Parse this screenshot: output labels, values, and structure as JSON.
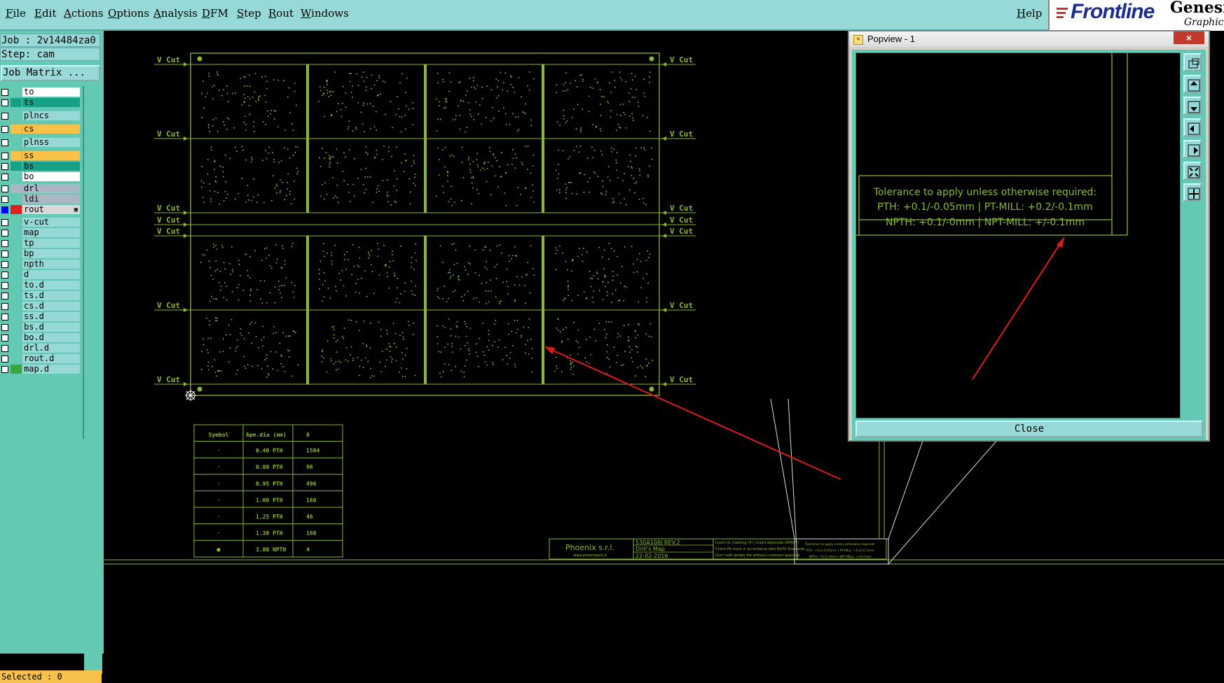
{
  "menu": {
    "items": [
      "File",
      "Edit",
      "Actions",
      "Options",
      "Analysis",
      "DFM",
      "Step",
      "Rout",
      "Windows"
    ],
    "help": "Help"
  },
  "brand": {
    "logo": "Frontline",
    "product": "Genesis",
    "tagline": "Graphic E"
  },
  "job_info": {
    "job": "Job : 2v14484za0",
    "step": "Step: cam",
    "matrix_button": "Job Matrix ..."
  },
  "layers": [
    {
      "name": "to",
      "color": "#ffffff",
      "swatch": "#63c9b3"
    },
    {
      "name": "ts",
      "color": "#16a085",
      "swatch": "#16a085"
    },
    {
      "name": "plncs",
      "color": "#97d9d6",
      "swatch": "#63c9b3"
    },
    {
      "name": "cs",
      "color": "#f7c14a",
      "swatch": "#f7c14a"
    },
    {
      "name": "plnss",
      "color": "#97d9d6",
      "swatch": "#63c9b3"
    },
    {
      "name": "ss",
      "color": "#f7c14a",
      "swatch": "#f7c14a"
    },
    {
      "name": "bs",
      "color": "#16a085",
      "swatch": "#16a085"
    },
    {
      "name": "bo",
      "color": "#ffffff",
      "swatch": "#63c9b3"
    },
    {
      "name": "drl",
      "color": "#a9b8c2",
      "swatch": "#a9b8c2"
    },
    {
      "name": "ldi",
      "color": "#a9b8c2",
      "swatch": "#63c9b3"
    },
    {
      "name": "rout",
      "color": "#d8d8d8",
      "swatch": "#e02020",
      "active": true
    },
    {
      "name": "v-cut",
      "color": "#97d9d6",
      "swatch": "#63c9b3"
    },
    {
      "name": "map",
      "color": "#97d9d6",
      "swatch": "#63c9b3"
    },
    {
      "name": "tp",
      "color": "#97d9d6",
      "swatch": "#63c9b3"
    },
    {
      "name": "bp",
      "color": "#97d9d6",
      "swatch": "#63c9b3"
    },
    {
      "name": "npth",
      "color": "#97d9d6",
      "swatch": "#63c9b3"
    },
    {
      "name": "d",
      "color": "#97d9d6",
      "swatch": "#63c9b3"
    },
    {
      "name": "to.d",
      "color": "#97d9d6",
      "swatch": "#63c9b3"
    },
    {
      "name": "ts.d",
      "color": "#97d9d6",
      "swatch": "#63c9b3"
    },
    {
      "name": "cs.d",
      "color": "#97d9d6",
      "swatch": "#63c9b3"
    },
    {
      "name": "ss.d",
      "color": "#97d9d6",
      "swatch": "#63c9b3"
    },
    {
      "name": "bs.d",
      "color": "#97d9d6",
      "swatch": "#63c9b3"
    },
    {
      "name": "bo.d",
      "color": "#97d9d6",
      "swatch": "#63c9b3"
    },
    {
      "name": "drl.d",
      "color": "#97d9d6",
      "swatch": "#63c9b3"
    },
    {
      "name": "rout.d",
      "color": "#97d9d6",
      "swatch": "#63c9b3"
    },
    {
      "name": "map.d",
      "color": "#97d9d6",
      "swatch": "#3aa53a"
    }
  ],
  "status": {
    "selected": "Selected : 0"
  },
  "canvas": {
    "vcut_label": "V Cut",
    "drill_table": {
      "headers": [
        "Symbol",
        "Ape.dia (mm)",
        "0"
      ],
      "rows": [
        [
          "·",
          "0.40 PTH",
          "1504"
        ],
        [
          "·",
          "0.80 PTH",
          "96"
        ],
        [
          "·",
          "0.95 PTH",
          "496"
        ],
        [
          "·",
          "1.00 PTH",
          "160"
        ],
        [
          "·",
          "1.25 PTH",
          "46"
        ],
        [
          "·",
          "1.30 PTH",
          "160"
        ],
        [
          "●",
          "3.00 NPTH",
          "4"
        ]
      ]
    },
    "title_block": {
      "company": "Phoenix s.r.l.",
      "website": "www.phoenixpcb.it",
      "part": "530A108J REV.2",
      "doc": "Drill's Map",
      "date": "22-02-2016",
      "notes": [
        "Insert UL marking (if) | Insert datecode (WWYY)",
        "Check Pb mark in accordance with RoHS Standards",
        "Don't edit gerber file without customer approval"
      ],
      "tolerance_mini": [
        "Tolerance to apply unless otherwise required:",
        "PTH: +0.1/-0.05mm | PT-MILL: +0.2/-0.1mm",
        "NPTH: +0.1/-0mm | NPT-MILL: +/-0.1mm"
      ]
    }
  },
  "popview": {
    "title": "Popview - 1",
    "close_x": "×",
    "close_button": "Close",
    "tolerance": [
      "Tolerance to apply unless otherwise required:",
      "PTH: +0.1/-0.05mm | PT-MILL: +0.2/-0.1mm",
      "NPTH: +0.1/-0mm | NPT-MILL: +/-0.1mm"
    ],
    "tools": [
      "zoom-home-icon",
      "pan-up-icon",
      "pan-down-icon",
      "pan-left-icon",
      "pan-right-icon",
      "zoom-fit-icon",
      "zoom-extents-icon"
    ]
  },
  "colors": {
    "board": "#8ab832",
    "background": "#000000",
    "panel": "#63c9b3",
    "menu": "#97d9d6",
    "arrow": "#e01b1b"
  }
}
